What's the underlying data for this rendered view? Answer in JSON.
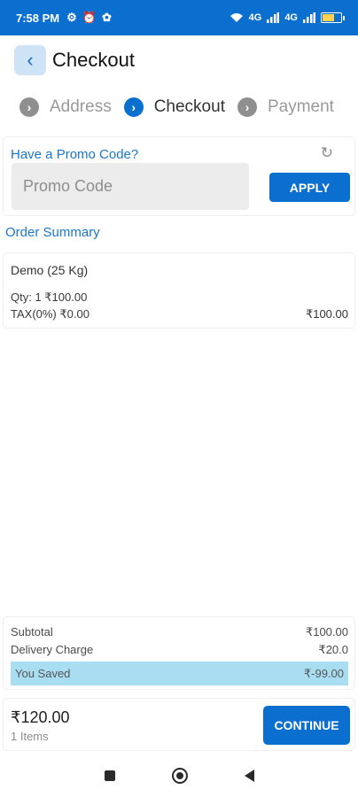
{
  "status_bar": {
    "time": "7:58 PM",
    "left_icons": [
      "⚙",
      "⏰",
      "✿"
    ],
    "network_a": "4G",
    "network_b": "4G",
    "battery_level": 0.6,
    "battery_text": "53"
  },
  "header": {
    "back_icon": "‹",
    "title": "Checkout"
  },
  "steps": [
    {
      "label": "Address",
      "icon": "›",
      "state": "inactive"
    },
    {
      "label": "Checkout",
      "icon": "›",
      "state": "active"
    },
    {
      "label": "Payment",
      "icon": "›",
      "state": "inactive"
    }
  ],
  "promo": {
    "title": "Have a Promo Code?",
    "refresh_icon": "↻",
    "placeholder": "Promo Code",
    "value": "",
    "apply_label": "APPLY"
  },
  "order_summary": {
    "title": "Order Summary",
    "item": {
      "name": "Demo (25 Kg)",
      "qty_line": "Qty: 1   ₹100.00",
      "tax_line": "TAX(0%)   ₹0.00",
      "total": "₹100.00"
    }
  },
  "summary": {
    "subtotal_label": "Subtotal",
    "subtotal_value": "₹100.00",
    "delivery_label": "Delivery Charge",
    "delivery_value": "₹20.0",
    "saved_label": "You Saved",
    "saved_value": "₹-99.00"
  },
  "footer": {
    "total": "₹120.00",
    "items": "1 Items",
    "continue_label": "CONTINUE"
  },
  "colors": {
    "primary": "#0b6fd0",
    "link": "#1b76c9",
    "saved_bg": "#a9def2"
  }
}
